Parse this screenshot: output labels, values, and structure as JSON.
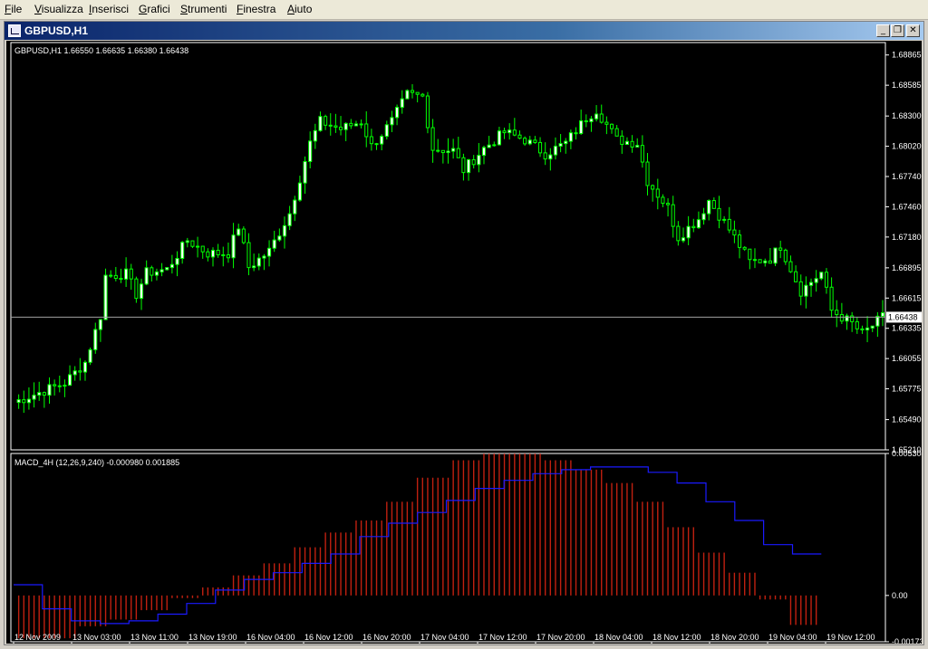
{
  "menu": {
    "items": [
      {
        "label": "File"
      },
      {
        "label": "Visualizza"
      },
      {
        "label": "Inserisci"
      },
      {
        "label": "Grafici"
      },
      {
        "label": "Strumenti"
      },
      {
        "label": "Finestra"
      },
      {
        "label": "Aiuto"
      }
    ]
  },
  "window": {
    "title": "GBPUSD,H1",
    "icon": "chart-window-icon",
    "buttons": {
      "minimize": "_",
      "restore": "❐",
      "close": "✕"
    }
  },
  "colors": {
    "background": "#000000",
    "candle": "#00ff00",
    "candle_body_up": "#ffffff",
    "candle_body_down": "#000000",
    "price_line": "#a0a0a0",
    "macd_hist": "#c02010",
    "macd_signal": "#1a1aff",
    "frame": "#ffffff"
  },
  "chart_data": [
    {
      "type": "candlestick",
      "panel": "price",
      "label": "GBPUSD,H1  1.66550 1.66635 1.66380 1.66438",
      "y_axis_ticks": [
        "1.68865",
        "1.68585",
        "1.68300",
        "1.68020",
        "1.67740",
        "1.67460",
        "1.67180",
        "1.66895",
        "1.66615",
        "1.66335",
        "1.66055",
        "1.65775",
        "1.65490",
        "1.65210"
      ],
      "ylim": [
        1.6521,
        1.6898
      ],
      "current_price_label": "1.66438",
      "current_price": 1.66438,
      "waypoints": [
        [
          0,
          1.6565
        ],
        [
          10,
          1.6583
        ],
        [
          14,
          1.6602
        ],
        [
          17,
          1.6645
        ],
        [
          18,
          1.6682
        ],
        [
          22,
          1.6684
        ],
        [
          24,
          1.6665
        ],
        [
          26,
          1.6685
        ],
        [
          30,
          1.6688
        ],
        [
          34,
          1.6715
        ],
        [
          38,
          1.6703
        ],
        [
          42,
          1.6703
        ],
        [
          44,
          1.6728
        ],
        [
          46,
          1.669
        ],
        [
          50,
          1.6705
        ],
        [
          54,
          1.674
        ],
        [
          58,
          1.6805
        ],
        [
          60,
          1.6825
        ],
        [
          64,
          1.6818
        ],
        [
          68,
          1.6825
        ],
        [
          70,
          1.6802
        ],
        [
          74,
          1.6825
        ],
        [
          77,
          1.685
        ],
        [
          80,
          1.6848
        ],
        [
          82,
          1.68
        ],
        [
          86,
          1.6798
        ],
        [
          88,
          1.678
        ],
        [
          92,
          1.68
        ],
        [
          96,
          1.6815
        ],
        [
          100,
          1.6808
        ],
        [
          104,
          1.6795
        ],
        [
          108,
          1.6805
        ],
        [
          112,
          1.6828
        ],
        [
          114,
          1.6836
        ],
        [
          118,
          1.6808
        ],
        [
          122,
          1.6805
        ],
        [
          124,
          1.677
        ],
        [
          128,
          1.6745
        ],
        [
          130,
          1.6718
        ],
        [
          134,
          1.6735
        ],
        [
          136,
          1.6752
        ],
        [
          140,
          1.6725
        ],
        [
          144,
          1.6695
        ],
        [
          148,
          1.6698
        ],
        [
          150,
          1.671
        ],
        [
          154,
          1.6668
        ],
        [
          158,
          1.6685
        ],
        [
          160,
          1.665
        ],
        [
          164,
          1.6638
        ],
        [
          166,
          1.6628
        ],
        [
          170,
          1.6644
        ]
      ]
    },
    {
      "type": "bar",
      "panel": "indicator",
      "label": "MACD_4H (12,26,9,240) -0.000980 0.001885",
      "y_axis_ticks": [
        "0.005304",
        "0.00",
        "-0.00173"
      ],
      "ylim": [
        -0.00173,
        0.005304
      ],
      "hist_steps": [
        -0.0016,
        -0.0016,
        -0.00115,
        -0.0009,
        -0.00055,
        -0.0001,
        0.0003,
        0.00075,
        0.0012,
        0.0018,
        0.00235,
        0.0028,
        0.0035,
        0.0044,
        0.00505,
        0.0053,
        0.0053,
        0.00505,
        0.0047,
        0.0042,
        0.0035,
        0.00255,
        0.0016,
        0.00085,
        -0.00015,
        -0.0011
      ],
      "signal_steps": [
        0.0004,
        -0.0005,
        -0.00095,
        -0.00105,
        -0.00095,
        -0.0007,
        -0.0003,
        0.0002,
        0.0006,
        0.00085,
        0.0012,
        0.00155,
        0.0022,
        0.0027,
        0.0031,
        0.00355,
        0.004,
        0.0043,
        0.00455,
        0.0047,
        0.0048,
        0.0048,
        0.0046,
        0.0042,
        0.0035,
        0.0028,
        0.0019,
        0.00155
      ]
    }
  ],
  "x_axis_ticks": [
    "12 Nov 2009",
    "13 Nov 03:00",
    "13 Nov 11:00",
    "13 Nov 19:00",
    "16 Nov 04:00",
    "16 Nov 12:00",
    "16 Nov 20:00",
    "17 Nov 04:00",
    "17 Nov 12:00",
    "17 Nov 20:00",
    "18 Nov 04:00",
    "18 Nov 12:00",
    "18 Nov 20:00",
    "19 Nov 04:00",
    "19 Nov 12:00"
  ]
}
